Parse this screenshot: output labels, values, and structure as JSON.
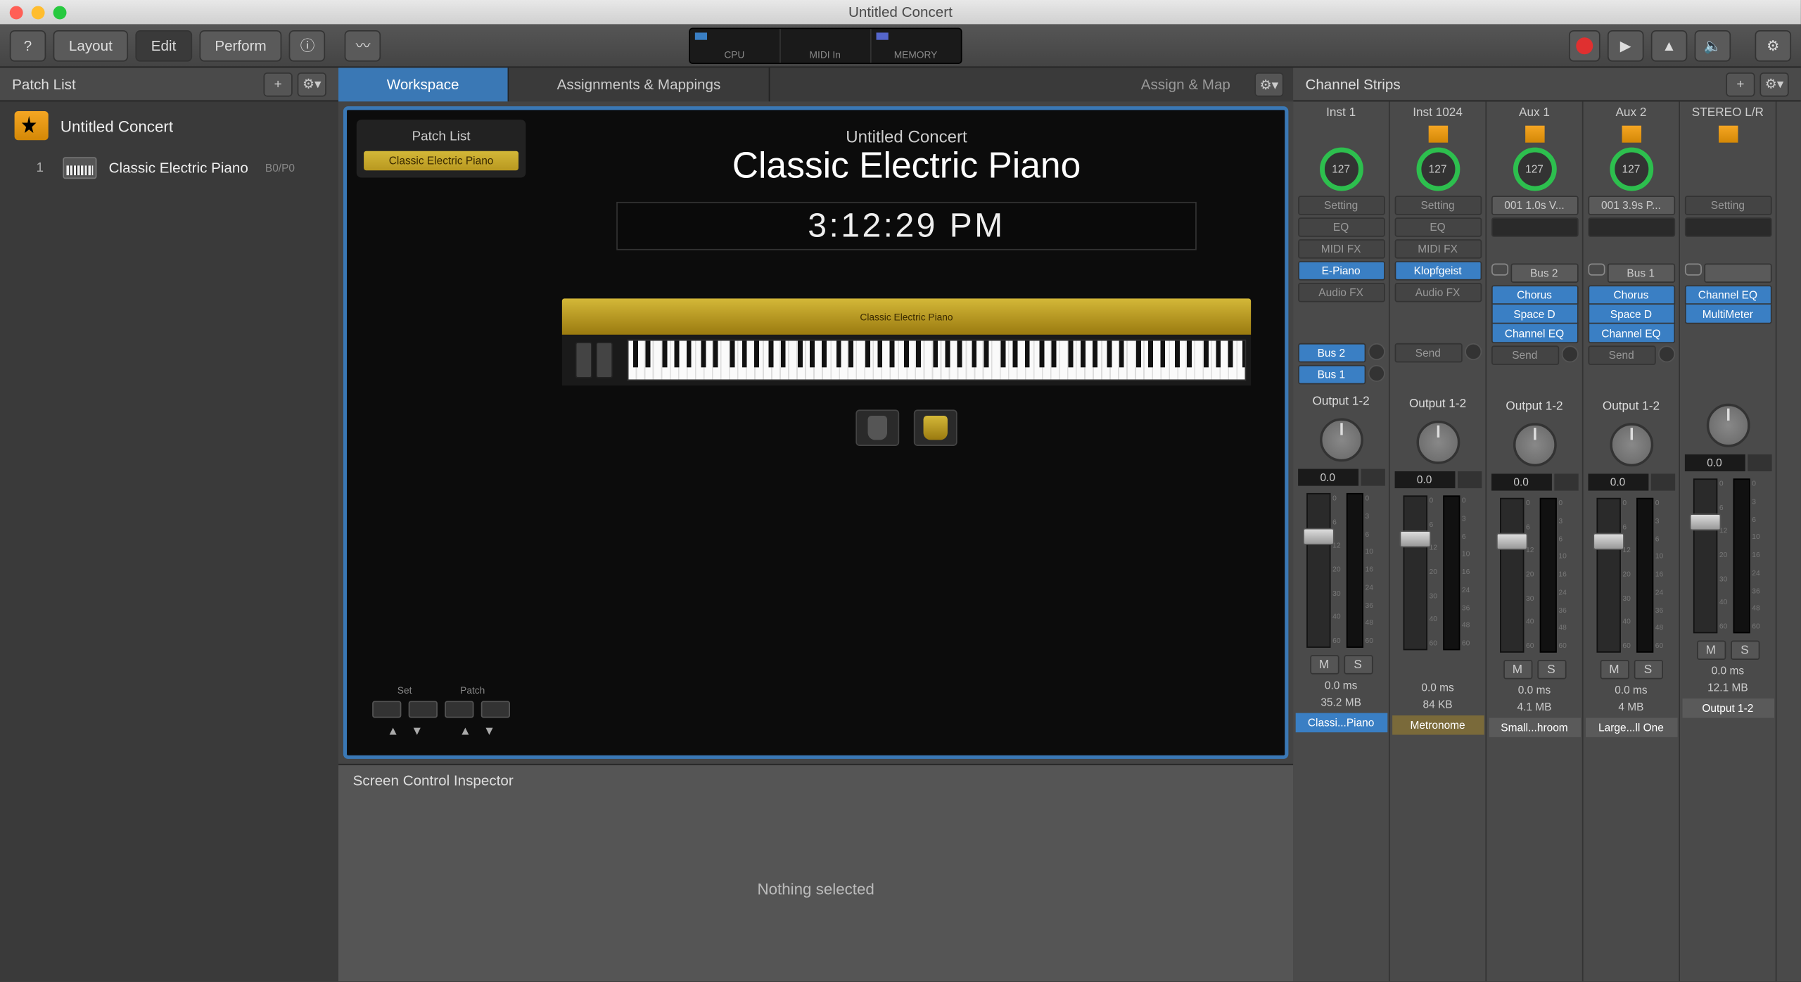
{
  "window": {
    "title": "Untitled Concert"
  },
  "toolbar": {
    "layout": "Layout",
    "edit": "Edit",
    "perform": "Perform",
    "lcd": {
      "cpu": "CPU",
      "midi": "MIDI In",
      "memory": "MEMORY"
    }
  },
  "patch_list": {
    "title": "Patch List",
    "concert": "Untitled Concert",
    "patches": [
      {
        "idx": "1",
        "name": "Classic Electric Piano",
        "code": "B0/P0"
      }
    ]
  },
  "center": {
    "tabs": {
      "workspace": "Workspace",
      "assignments": "Assignments & Mappings",
      "assign_map": "Assign & Map"
    },
    "ws_patch_list": "Patch List",
    "ws_patch_item": "Classic Electric Piano",
    "ws_sub": "Untitled Concert",
    "ws_title": "Classic Electric Piano",
    "ws_clock": "3:12:29 PM",
    "kb_label": "Classic Electric Piano",
    "nav": {
      "set": "Set",
      "patch": "Patch"
    }
  },
  "inspector": {
    "title": "Screen Control Inspector",
    "body": "Nothing selected"
  },
  "channel_strips": {
    "title": "Channel Strips",
    "strips": [
      {
        "name": "Inst 1",
        "icon": false,
        "knob": "127",
        "setting": "Setting",
        "eq": "EQ",
        "midi_fx": "MIDI FX",
        "instrument": {
          "label": "E-Piano",
          "blue": true
        },
        "audio_fx": "Audio FX",
        "fx": [],
        "sends": [
          "Bus 2",
          "Bus 1"
        ],
        "output": "Output 1-2",
        "pan": "0.0",
        "ms": true,
        "latency": "0.0 ms",
        "size": "35.2 MB",
        "label": "Classi...Piano",
        "label_cls": "sl-1"
      },
      {
        "name": "Inst 1024",
        "icon": true,
        "knob": "127",
        "setting": "Setting",
        "eq": "EQ",
        "midi_fx": "MIDI FX",
        "instrument": {
          "label": "Klopfgeist",
          "blue": true
        },
        "audio_fx": "Audio FX",
        "fx": [],
        "sends": [
          "Send"
        ],
        "output": "Output 1-2",
        "pan": "0.0",
        "ms": false,
        "latency": "0.0 ms",
        "size": "84 KB",
        "label": "Metronome",
        "label_cls": "sl-2"
      },
      {
        "name": "Aux 1",
        "icon": true,
        "knob": "127",
        "setting": "001 1.0s V...",
        "eq": "",
        "midi_fx": "",
        "instrument": {
          "label": "Bus 2",
          "blue": false,
          "link": true
        },
        "audio_fx": "",
        "fx": [
          "Chorus",
          "Space D",
          "Channel EQ"
        ],
        "sends": [
          "Send"
        ],
        "output": "Output 1-2",
        "pan": "0.0",
        "ms": true,
        "latency": "0.0 ms",
        "size": "4.1 MB",
        "label": "Small...hroom",
        "label_cls": "sl-3"
      },
      {
        "name": "Aux 2",
        "icon": true,
        "knob": "127",
        "setting": "001 3.9s P...",
        "eq": "",
        "midi_fx": "",
        "instrument": {
          "label": "Bus 1",
          "blue": false,
          "link": true
        },
        "audio_fx": "",
        "fx": [
          "Chorus",
          "Space D",
          "Channel EQ"
        ],
        "sends": [
          "Send"
        ],
        "output": "Output 1-2",
        "pan": "0.0",
        "ms": true,
        "latency": "0.0 ms",
        "size": "4 MB",
        "label": "Large...ll One",
        "label_cls": "sl-4"
      },
      {
        "name": "STEREO L/R",
        "icon": true,
        "knob": "",
        "setting": "Setting",
        "eq": "",
        "midi_fx": "",
        "instrument": {
          "label": "",
          "blue": false,
          "link": true
        },
        "audio_fx": "",
        "fx": [
          "Channel EQ",
          "MultiMeter"
        ],
        "sends": [],
        "output": "",
        "pan": "0.0",
        "ms": true,
        "latency": "0.0 ms",
        "size": "12.1 MB",
        "label": "Output 1-2",
        "label_cls": "sl-5"
      }
    ]
  }
}
